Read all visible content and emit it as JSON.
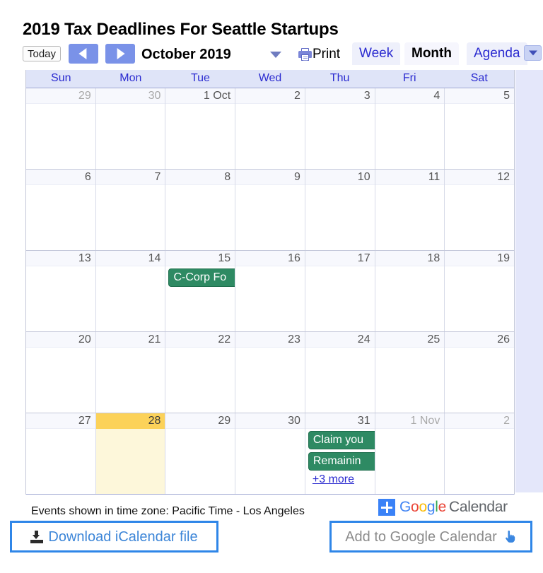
{
  "page_title": "2019 Tax Deadlines For Seattle Startups",
  "toolbar": {
    "today_label": "Today",
    "prev_label": "",
    "next_label": "",
    "current_period": "October 2019",
    "print_label": "Print",
    "views": [
      {
        "label": "Week",
        "active": false
      },
      {
        "label": "Month",
        "active": true
      },
      {
        "label": "Agenda",
        "active": false
      }
    ],
    "dropdown_icon": "chevron-down-icon",
    "period_caret_icon": "caret-down-icon",
    "print_icon": "printer-icon"
  },
  "calendar": {
    "day_headers": [
      "Sun",
      "Mon",
      "Tue",
      "Wed",
      "Thu",
      "Fri",
      "Sat"
    ],
    "weeks": [
      [
        {
          "num": "29",
          "other": true,
          "today": false,
          "events": []
        },
        {
          "num": "30",
          "other": true,
          "today": false,
          "events": []
        },
        {
          "num": "1 Oct",
          "other": false,
          "today": false,
          "events": []
        },
        {
          "num": "2",
          "other": false,
          "today": false,
          "events": []
        },
        {
          "num": "3",
          "other": false,
          "today": false,
          "events": []
        },
        {
          "num": "4",
          "other": false,
          "today": false,
          "events": []
        },
        {
          "num": "5",
          "other": false,
          "today": false,
          "events": []
        }
      ],
      [
        {
          "num": "6",
          "other": false,
          "today": false,
          "events": []
        },
        {
          "num": "7",
          "other": false,
          "today": false,
          "events": []
        },
        {
          "num": "8",
          "other": false,
          "today": false,
          "events": []
        },
        {
          "num": "9",
          "other": false,
          "today": false,
          "events": []
        },
        {
          "num": "10",
          "other": false,
          "today": false,
          "events": []
        },
        {
          "num": "11",
          "other": false,
          "today": false,
          "events": []
        },
        {
          "num": "12",
          "other": false,
          "today": false,
          "events": []
        }
      ],
      [
        {
          "num": "13",
          "other": false,
          "today": false,
          "events": []
        },
        {
          "num": "14",
          "other": false,
          "today": false,
          "events": []
        },
        {
          "num": "15",
          "other": false,
          "today": false,
          "events": [
            "C-Corp Fo"
          ]
        },
        {
          "num": "16",
          "other": false,
          "today": false,
          "events": []
        },
        {
          "num": "17",
          "other": false,
          "today": false,
          "events": []
        },
        {
          "num": "18",
          "other": false,
          "today": false,
          "events": []
        },
        {
          "num": "19",
          "other": false,
          "today": false,
          "events": []
        }
      ],
      [
        {
          "num": "20",
          "other": false,
          "today": false,
          "events": []
        },
        {
          "num": "21",
          "other": false,
          "today": false,
          "events": []
        },
        {
          "num": "22",
          "other": false,
          "today": false,
          "events": []
        },
        {
          "num": "23",
          "other": false,
          "today": false,
          "events": []
        },
        {
          "num": "24",
          "other": false,
          "today": false,
          "events": []
        },
        {
          "num": "25",
          "other": false,
          "today": false,
          "events": []
        },
        {
          "num": "26",
          "other": false,
          "today": false,
          "events": []
        }
      ],
      [
        {
          "num": "27",
          "other": false,
          "today": false,
          "events": []
        },
        {
          "num": "28",
          "other": false,
          "today": true,
          "events": []
        },
        {
          "num": "29",
          "other": false,
          "today": false,
          "events": []
        },
        {
          "num": "30",
          "other": false,
          "today": false,
          "events": []
        },
        {
          "num": "31",
          "other": false,
          "today": false,
          "events": [
            "Claim you",
            "Remainin"
          ],
          "more": "+3 more"
        },
        {
          "num": "1 Nov",
          "other": true,
          "today": false,
          "events": []
        },
        {
          "num": "2",
          "other": true,
          "today": false,
          "events": []
        }
      ]
    ],
    "event_color": "#2e8a63",
    "today_color": "#fcd259"
  },
  "footer": {
    "timezone_note": "Events shown in time zone: Pacific Time - Los Angeles",
    "logo": {
      "plus_icon": "plus-badge-icon",
      "google_letters": [
        "G",
        "o",
        "o",
        "g",
        "l",
        "e"
      ],
      "product": "Calendar"
    },
    "download_button": {
      "label": "Download iCalendar file",
      "icon": "download-icon",
      "color": "#3d86d8"
    },
    "add_button": {
      "label": "Add to Google Calendar",
      "icon": "pointing-hand-icon",
      "color": "#8b8b8b"
    },
    "border_color": "#2f86e8"
  }
}
